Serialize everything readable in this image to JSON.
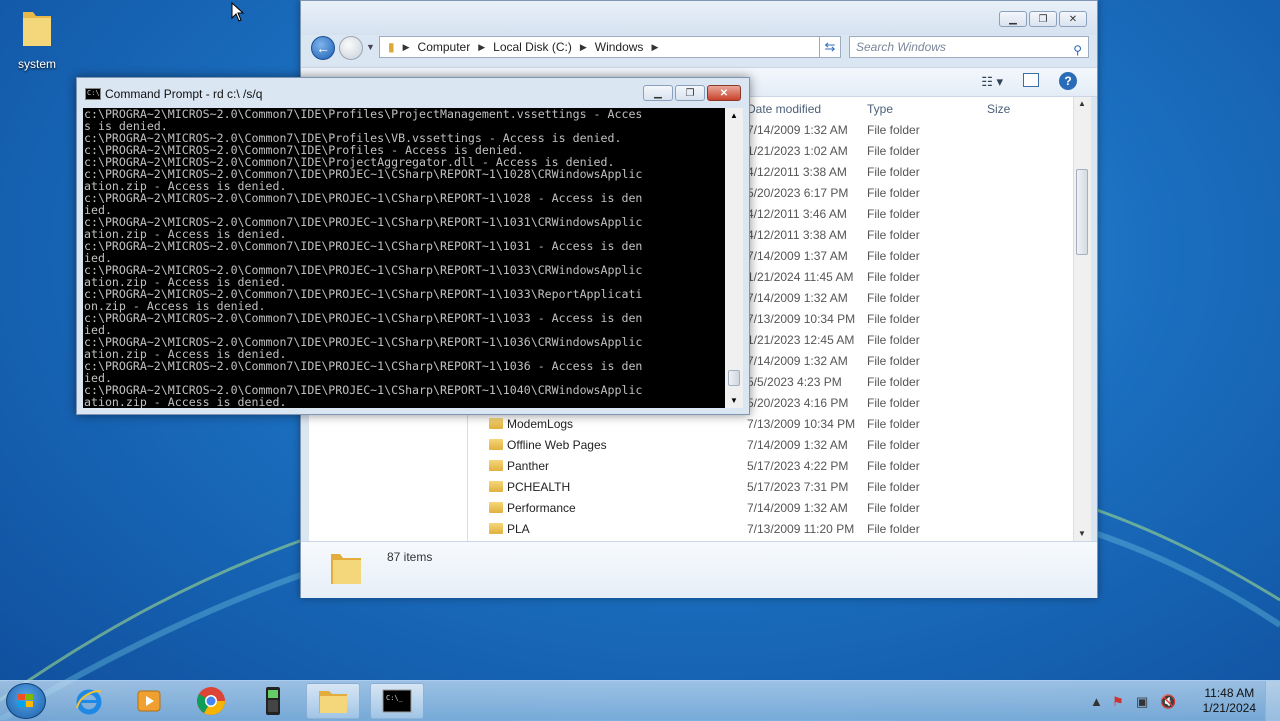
{
  "desktop": {
    "icon_label": "system"
  },
  "explorer": {
    "breadcrumb": [
      "Computer",
      "Local Disk (C:)",
      "Windows"
    ],
    "search_placeholder": "Search Windows",
    "columns": {
      "date": "Date modified",
      "type": "Type",
      "size": "Size"
    },
    "rows": [
      {
        "name": "",
        "date": "7/14/2009 1:32 AM",
        "type": "File folder"
      },
      {
        "name": "",
        "date": "1/21/2023 1:02 AM",
        "type": "File folder"
      },
      {
        "name": "",
        "date": "4/12/2011 3:38 AM",
        "type": "File folder"
      },
      {
        "name": "",
        "date": "5/20/2023 6:17 PM",
        "type": "File folder"
      },
      {
        "name": "",
        "date": "4/12/2011 3:46 AM",
        "type": "File folder"
      },
      {
        "name": "",
        "date": "4/12/2011 3:38 AM",
        "type": "File folder"
      },
      {
        "name": "",
        "date": "7/14/2009 1:37 AM",
        "type": "File folder"
      },
      {
        "name": "",
        "date": "1/21/2024 11:45 AM",
        "type": "File folder"
      },
      {
        "name": "",
        "date": "7/14/2009 1:32 AM",
        "type": "File folder"
      },
      {
        "name": "",
        "date": "7/13/2009 10:34 PM",
        "type": "File folder"
      },
      {
        "name": "",
        "date": "1/21/2023 12:45 AM",
        "type": "File folder"
      },
      {
        "name": "",
        "date": "7/14/2009 1:32 AM",
        "type": "File folder"
      },
      {
        "name": "",
        "date": "5/5/2023 4:23 PM",
        "type": "File folder"
      },
      {
        "name": "",
        "date": "5/20/2023 4:16 PM",
        "type": "File folder"
      },
      {
        "name": "ModemLogs",
        "date": "7/13/2009 10:34 PM",
        "type": "File folder"
      },
      {
        "name": "Offline Web Pages",
        "date": "7/14/2009 1:32 AM",
        "type": "File folder"
      },
      {
        "name": "Panther",
        "date": "5/17/2023 4:22 PM",
        "type": "File folder"
      },
      {
        "name": "PCHEALTH",
        "date": "5/17/2023 7:31 PM",
        "type": "File folder"
      },
      {
        "name": "Performance",
        "date": "7/14/2009 1:32 AM",
        "type": "File folder"
      },
      {
        "name": "PLA",
        "date": "7/13/2009 11:20 PM",
        "type": "File folder"
      }
    ],
    "item_count": "87 items"
  },
  "cmd": {
    "title": "Command Prompt - rd  c:\\ /s/q",
    "output": "c:\\PROGRA~2\\MICROS~2.0\\Common7\\IDE\\Profiles\\ProjectManagement.vssettings - Acces\ns is denied.\nc:\\PROGRA~2\\MICROS~2.0\\Common7\\IDE\\Profiles\\VB.vssettings - Access is denied.\nc:\\PROGRA~2\\MICROS~2.0\\Common7\\IDE\\Profiles - Access is denied.\nc:\\PROGRA~2\\MICROS~2.0\\Common7\\IDE\\ProjectAggregator.dll - Access is denied.\nc:\\PROGRA~2\\MICROS~2.0\\Common7\\IDE\\PROJEC~1\\CSharp\\REPORT~1\\1028\\CRWindowsApplic\nation.zip - Access is denied.\nc:\\PROGRA~2\\MICROS~2.0\\Common7\\IDE\\PROJEC~1\\CSharp\\REPORT~1\\1028 - Access is den\nied.\nc:\\PROGRA~2\\MICROS~2.0\\Common7\\IDE\\PROJEC~1\\CSharp\\REPORT~1\\1031\\CRWindowsApplic\nation.zip - Access is denied.\nc:\\PROGRA~2\\MICROS~2.0\\Common7\\IDE\\PROJEC~1\\CSharp\\REPORT~1\\1031 - Access is den\nied.\nc:\\PROGRA~2\\MICROS~2.0\\Common7\\IDE\\PROJEC~1\\CSharp\\REPORT~1\\1033\\CRWindowsApplic\nation.zip - Access is denied.\nc:\\PROGRA~2\\MICROS~2.0\\Common7\\IDE\\PROJEC~1\\CSharp\\REPORT~1\\1033\\ReportApplicati\non.zip - Access is denied.\nc:\\PROGRA~2\\MICROS~2.0\\Common7\\IDE\\PROJEC~1\\CSharp\\REPORT~1\\1033 - Access is den\nied.\nc:\\PROGRA~2\\MICROS~2.0\\Common7\\IDE\\PROJEC~1\\CSharp\\REPORT~1\\1036\\CRWindowsApplic\nation.zip - Access is denied.\nc:\\PROGRA~2\\MICROS~2.0\\Common7\\IDE\\PROJEC~1\\CSharp\\REPORT~1\\1036 - Access is den\nied.\nc:\\PROGRA~2\\MICROS~2.0\\Common7\\IDE\\PROJEC~1\\CSharp\\REPORT~1\\1040\\CRWindowsApplic\nation.zip - Access is denied."
  },
  "taskbar": {
    "time": "11:48 AM",
    "date": "1/21/2024"
  }
}
